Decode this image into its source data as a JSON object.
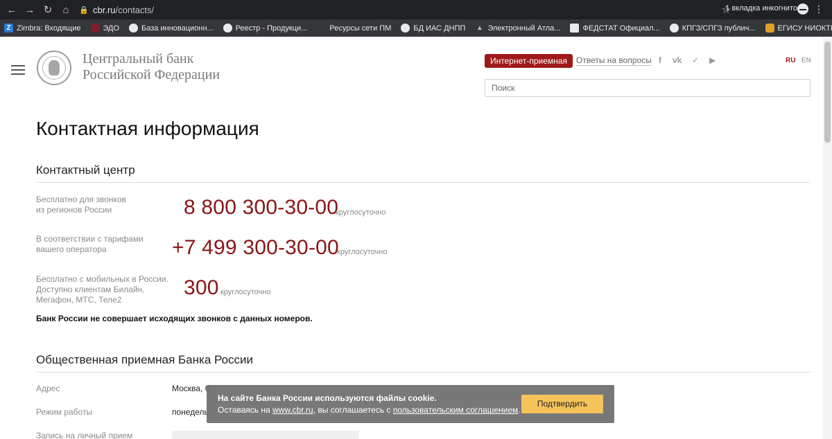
{
  "browser": {
    "url_host": "cbr.ru",
    "url_path": "/contacts/",
    "incognito_label": "1 вкладка инкогнито",
    "bookmarks": [
      {
        "label": "Zimbra: Входящие",
        "icon": "zimbra-icon"
      },
      {
        "label": "ЭДО",
        "icon": "edo-icon"
      },
      {
        "label": "База инновационн...",
        "icon": "globe-icon"
      },
      {
        "label": "Реестр - Продукци...",
        "icon": "globe-icon"
      },
      {
        "label": "Ресурсы сети ПМ",
        "icon": "blank-page-icon"
      },
      {
        "label": "БД ИАС ДНПП",
        "icon": "globe-icon"
      },
      {
        "label": "Электронный Атла...",
        "icon": "triangle-icon"
      },
      {
        "label": "ФЕДСТАТ Официал...",
        "icon": "fedstat-icon"
      },
      {
        "label": "КПГЗ/СПГЗ публич...",
        "icon": "globe-icon"
      },
      {
        "label": "ЕГИСУ НИОКТР",
        "icon": "database-icon"
      }
    ]
  },
  "header": {
    "logo_line1": "Центральный банк",
    "logo_line2": "Российской Федерации",
    "reception_label": "Интернет-приемная",
    "faq_label": "Ответы на вопросы",
    "lang_ru": "RU",
    "lang_en": "EN",
    "search_placeholder": "Поиск"
  },
  "main": {
    "title": "Контактная информация",
    "contact_center": {
      "title": "Контактный центр",
      "rows": [
        {
          "label_lines": [
            "Бесплатно для звонков",
            "из регионов России"
          ],
          "phone": "8 800 300-30-00",
          "hours": "круглосуточно"
        },
        {
          "label_lines": [
            "В соответствии с тарифами",
            "вашего оператора"
          ],
          "phone": "+7 499 300-30-00",
          "hours": "круглосуточно"
        },
        {
          "label_lines": [
            "Бесплатно с мобильных в России.",
            "Доступно клиентам Билайн,",
            "Мегафон, МТС, Теле2"
          ],
          "phone": "300",
          "hours": "круглосуточно"
        }
      ],
      "note": "Банк России не совершает исходящих звонков с данных номеров."
    },
    "reception": {
      "title": "Общественная приемная Банка России",
      "rows": [
        {
          "label": "Адрес",
          "value": "Москва, С"
        },
        {
          "label": "Режим работы",
          "value": "понедель"
        },
        {
          "label": "Запись на личный прием",
          "value": ""
        }
      ]
    }
  },
  "cookie": {
    "line1": "На сайте Банка России используются файлы cookie.",
    "line2_pre": "Оставаясь на ",
    "site_link": "www.cbr.ru",
    "line2_mid": ", вы соглашаетесь с ",
    "agreement_link": "пользовательским соглашением",
    "line2_post": ".",
    "confirm_label": "Подтвердить"
  },
  "colors": {
    "accent": "#a01919",
    "phone": "#8a1515",
    "cookie_button": "#f5c35a"
  }
}
